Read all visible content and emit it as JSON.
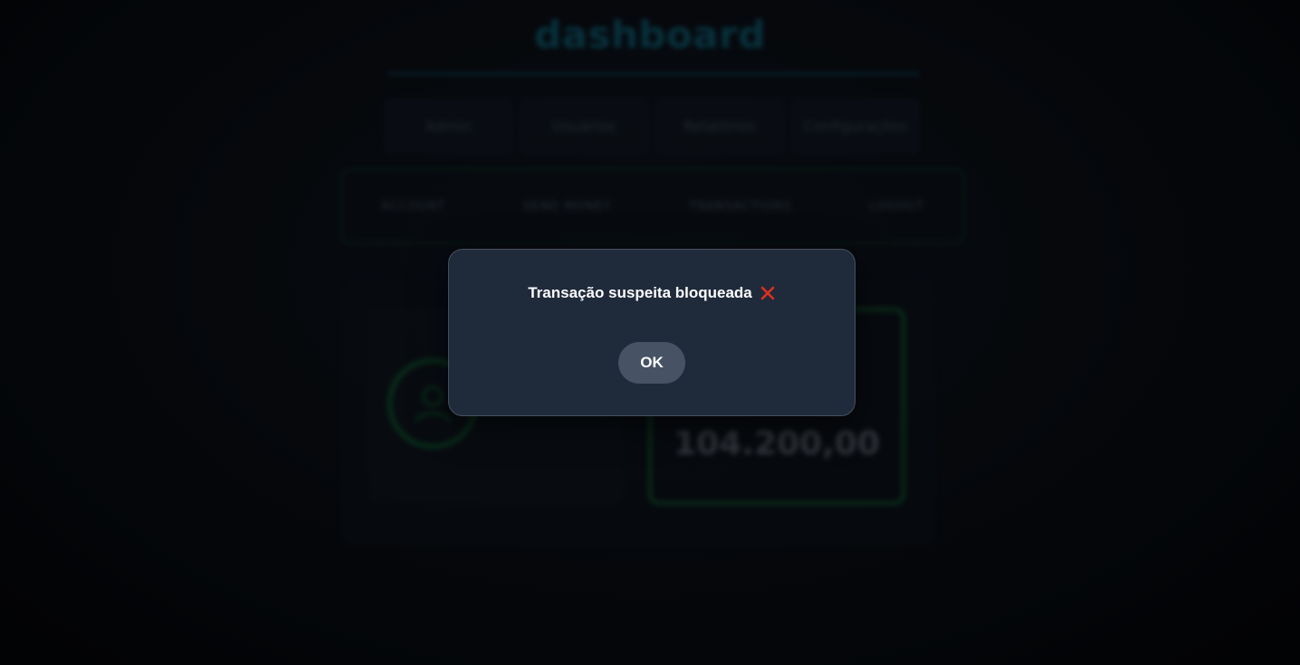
{
  "background": {
    "title": "dashboard",
    "tabs": [
      "Admin",
      "Usuários",
      "Relatórios",
      "Configurações"
    ],
    "menu": [
      "ACCOUNT",
      "SEND MONEY",
      "TRANSACTIONS",
      "LOGOUT"
    ],
    "balance": "104.200,00"
  },
  "modal": {
    "message": "Transação suspeita bloqueada",
    "status_icon": "x-icon",
    "ok_label": "OK"
  },
  "colors": {
    "modal_bg": "#1f2a3b",
    "button_bg": "#475364",
    "error_red": "#e0301e",
    "accent_green": "#11682f",
    "accent_teal": "#0e6f86"
  }
}
